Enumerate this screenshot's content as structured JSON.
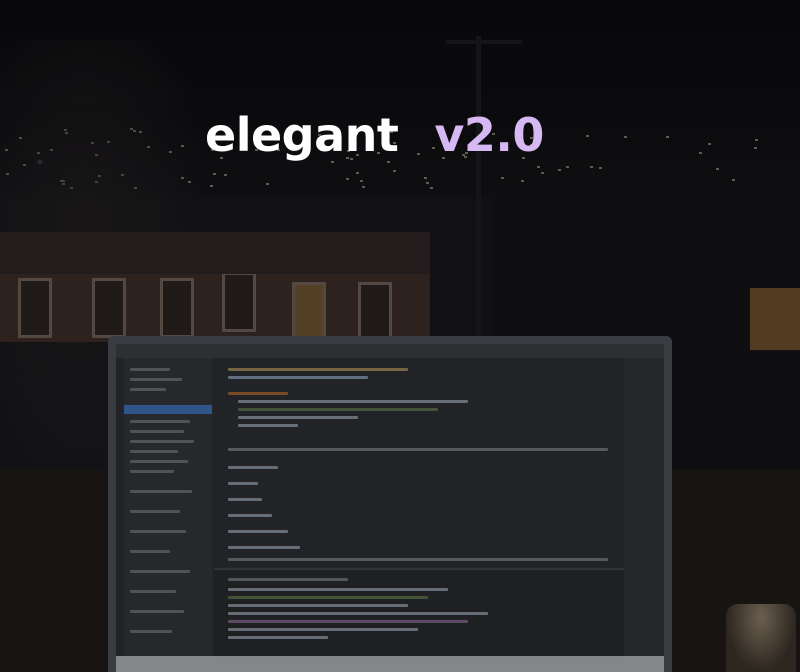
{
  "overlay": {
    "brand": "elegant",
    "version": "v2.0",
    "brand_color": "#ffffff",
    "version_color": "#d6b8f2"
  },
  "background": {
    "description_icon": "night-city-laptop-photo-icon"
  }
}
